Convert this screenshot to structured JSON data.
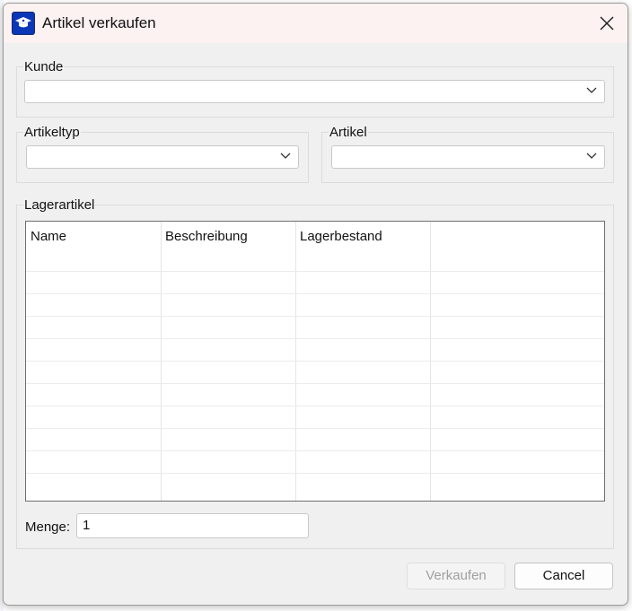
{
  "window": {
    "title": "Artikel verkaufen",
    "icon": "graduation-cap-icon"
  },
  "groups": {
    "kunde": {
      "label": "Kunde",
      "value": ""
    },
    "artikeltyp": {
      "label": "Artikeltyp",
      "value": ""
    },
    "artikel": {
      "label": "Artikel",
      "value": ""
    },
    "lagerartikel": {
      "label": "Lagerartikel"
    }
  },
  "table": {
    "columns": [
      "Name",
      "Beschreibung",
      "Lagerbestand"
    ],
    "rows": []
  },
  "menge": {
    "label": "Menge:",
    "value": "1"
  },
  "buttons": {
    "verkaufen": "Verkaufen",
    "cancel": "Cancel"
  },
  "colors": {
    "titlebar": "#fbf2f1",
    "window": "#f0f0f0",
    "icon": "#0a36b8"
  }
}
